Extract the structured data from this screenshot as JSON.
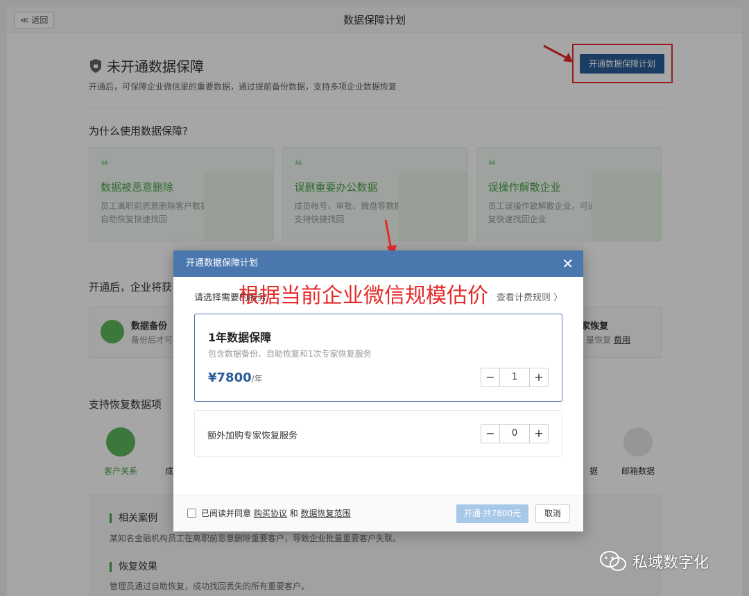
{
  "topbar": {
    "back_label": "≪ 返回",
    "title": "数据保障计划"
  },
  "status": {
    "title": "未开通数据保障",
    "desc": "开通后，可保障企业微信里的重要数据，通过提前备份数据，支持多项企业数据恢复",
    "open_button": "开通数据保障计划"
  },
  "why": {
    "title": "为什么使用数据保障?",
    "cards": [
      {
        "title": "数据被恶意删除",
        "desc1": "员工离职前恶意删除客户数据，可通过",
        "desc2": "自助恢复快速找回"
      },
      {
        "title": "误删重要办公数据",
        "desc1": "成员帐号、审批、微盘等数据误删，均",
        "desc2": "支持快捷找回"
      },
      {
        "title": "误操作解散企业",
        "desc1": "员工误操作致解散企业，可通过自助恢",
        "desc2": "复快速找回企业"
      }
    ]
  },
  "after": {
    "title": "开通后，企业将获",
    "left_title": "数据备份",
    "left_desc": "备份后才可",
    "right_title": "家恢复",
    "right_desc": "量恢复",
    "right_link": "费用"
  },
  "support": {
    "title": "支持恢复数据项",
    "items": [
      "客户关系",
      "成",
      "据",
      "邮箱数据"
    ]
  },
  "cases": {
    "head1": "相关案例",
    "text1": "某知名金融机构员工在离职前恶意删除重要客户，导致企业批量重要客户失联。",
    "head2": "恢复效果",
    "text2": "管理员通过自助恢复，成功找回丢失的所有重要客户。"
  },
  "modal": {
    "title": "开通数据保障计划",
    "close": "✕",
    "choose_label": "请选择需要的服务",
    "rule_link": "查看计费规则 〉",
    "annotation": "根据当前企业微信规模估价",
    "plan": {
      "title": "1年数据保障",
      "desc": "包含数据备份、自助恢复和1次专家恢复服务",
      "price": "¥7800",
      "unit": "/年",
      "qty": "1"
    },
    "extra": {
      "label": "额外加购专家恢复服务",
      "qty": "0"
    },
    "footer": {
      "agree_prefix": "已阅读并同意",
      "agree_link1": "购买协议",
      "agree_and": "和",
      "agree_link2": "数据恢复范围",
      "confirm": "开通·共7800元",
      "cancel": "取消"
    },
    "minus": "−",
    "plus": "+"
  },
  "watermark": "私域数字化",
  "colors": {
    "primary": "#2a5d99",
    "header": "#4a77ae",
    "green": "#4aa24a",
    "annotation": "#e52a2a"
  }
}
